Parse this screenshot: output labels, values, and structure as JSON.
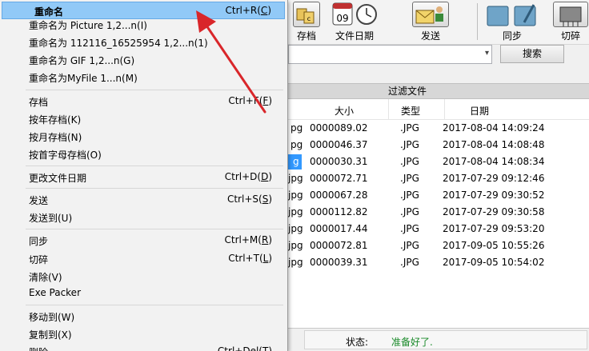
{
  "toolbar": {
    "buttons": [
      {
        "label": "存档",
        "icon": "archive-folder-icon"
      },
      {
        "label": "文件日期",
        "icon": "calendar-clock-icon"
      },
      {
        "label": "发送",
        "icon": "send-people-icon"
      },
      {
        "label": "同步",
        "icon": "sync-folder-icon"
      },
      {
        "label": "切碎",
        "icon": "shred-icon"
      }
    ],
    "calendar_day": "09"
  },
  "search": {
    "combo_value": "",
    "button_label": "搜索"
  },
  "filter_bar": {
    "label": "过滤文件"
  },
  "file_list": {
    "columns": [
      "大小",
      "类型",
      "日期"
    ],
    "rows": [
      {
        "name": "pg",
        "size": "0000089.02",
        "type": ".JPG",
        "date": "2017-08-04 14:09:24",
        "selected": false
      },
      {
        "name": "pg",
        "size": "0000046.37",
        "type": ".JPG",
        "date": "2017-08-04 14:08:48",
        "selected": false
      },
      {
        "name": "g",
        "size": "0000030.31",
        "type": ".JPG",
        "date": "2017-08-04 14:08:34",
        "selected": true
      },
      {
        "name": "jpg",
        "size": "0000072.71",
        "type": ".JPG",
        "date": "2017-07-29 09:12:46",
        "selected": false
      },
      {
        "name": "jpg",
        "size": "0000067.28",
        "type": ".JPG",
        "date": "2017-07-29 09:30:52",
        "selected": false
      },
      {
        "name": "jpg",
        "size": "0000112.82",
        "type": ".JPG",
        "date": "2017-07-29 09:30:58",
        "selected": false
      },
      {
        "name": "jpg",
        "size": "0000017.44",
        "type": ".JPG",
        "date": "2017-07-29 09:53:20",
        "selected": false
      },
      {
        "name": "jpg",
        "size": "0000072.81",
        "type": ".JPG",
        "date": "2017-09-05 10:55:26",
        "selected": false
      },
      {
        "name": "jpg",
        "size": "0000039.31",
        "type": ".JPG",
        "date": "2017-09-05 10:54:02",
        "selected": false
      }
    ]
  },
  "status": {
    "label": "状态:",
    "text": "准备好了."
  },
  "menu": {
    "rename": {
      "label": "重命名",
      "shortcut_pre": "Ctrl+R(",
      "shortcut_key": "C",
      "shortcut_post": ")"
    },
    "items": [
      {
        "id": "rename-picture",
        "label": "重命名为 Picture 1,2...n(I)",
        "shortcut": ""
      },
      {
        "id": "rename-timestamp",
        "label": "重命名为 112116_16525954 1,2...n(1)",
        "shortcut": ""
      },
      {
        "id": "rename-gif",
        "label": "重命名为 GIF 1,2...n(G)",
        "shortcut": ""
      },
      {
        "id": "rename-myfile",
        "label": "重命名为MyFile 1...n(M)",
        "shortcut": ""
      },
      {
        "id": "archive",
        "label": "存档",
        "shortcut_pre": "Ctrl+F(",
        "shortcut_key": "F",
        "shortcut_post": ")"
      },
      {
        "id": "archive-by-year",
        "label": "按年存档(K)",
        "shortcut": ""
      },
      {
        "id": "archive-by-month",
        "label": "按月存档(N)",
        "shortcut": ""
      },
      {
        "id": "archive-by-initial",
        "label": "按首字母存档(O)",
        "shortcut": ""
      },
      {
        "id": "change-file-date",
        "label": "更改文件日期",
        "shortcut_pre": "Ctrl+D(",
        "shortcut_key": "D",
        "shortcut_post": ")"
      },
      {
        "id": "send",
        "label": "发送",
        "shortcut_pre": "Ctrl+S(",
        "shortcut_key": "S",
        "shortcut_post": ")"
      },
      {
        "id": "send-to",
        "label": "发送到(U)",
        "shortcut": ""
      },
      {
        "id": "sync",
        "label": "同步",
        "shortcut_pre": "Ctrl+M(",
        "shortcut_key": "R",
        "shortcut_post": ")"
      },
      {
        "id": "shred",
        "label": "切碎",
        "shortcut_pre": "Ctrl+T(",
        "shortcut_key": "L",
        "shortcut_post": ")"
      },
      {
        "id": "clear",
        "label": "清除(V)",
        "shortcut": ""
      },
      {
        "id": "exe-packer",
        "label": "Exe Packer",
        "shortcut": ""
      },
      {
        "id": "move-to",
        "label": "移动到(W)",
        "shortcut": ""
      },
      {
        "id": "copy-to",
        "label": "复制到(X)",
        "shortcut": ""
      },
      {
        "id": "delete",
        "label": "删除",
        "shortcut_pre": "Ctrl+Del(",
        "shortcut_key": "T",
        "shortcut_post": ")"
      }
    ]
  },
  "colors": {
    "highlight": "#91c9f7",
    "annotation_arrow": "#d9262a",
    "status_ok": "#1a8a2a",
    "selection": "#3399ff"
  }
}
